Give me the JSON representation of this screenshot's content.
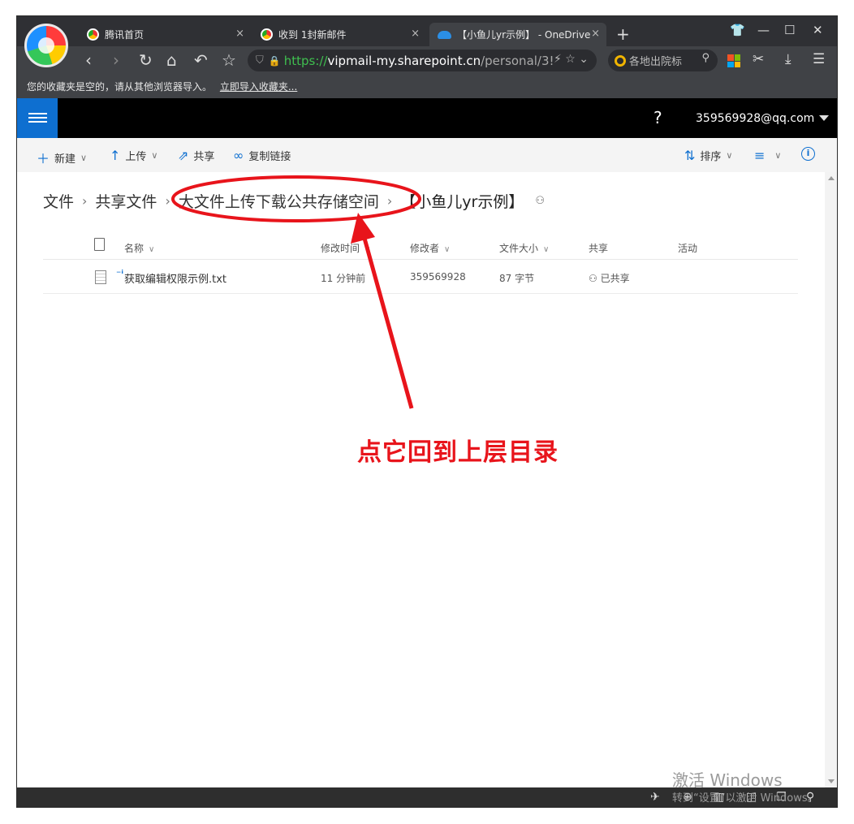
{
  "browser": {
    "tabs": [
      {
        "label": "腾讯首页",
        "close": "×"
      },
      {
        "label": "收到 1封新邮件",
        "close": "×"
      },
      {
        "label": "【小鱼儿yr示例】 - OneDrive",
        "close": "×"
      }
    ],
    "new_tab": "+",
    "url": {
      "scheme": "https://",
      "host": "vipmail-my.sharepoint.cn",
      "path": "/personal/3!"
    },
    "search_placeholder": "各地出院标",
    "bookmarks": {
      "message": "您的收藏夹是空的，请从其他浏览器导入。",
      "link": "立即导入收藏夹..."
    }
  },
  "header": {
    "help": "?",
    "account": "359569928@qq.com"
  },
  "commands": {
    "new": "新建",
    "upload": "上传",
    "share": "共享",
    "copy_link": "复制链接",
    "sort": "排序"
  },
  "breadcrumb": {
    "items": [
      "文件",
      "共享文件",
      "大文件上传下载公共存储空间",
      "【小鱼儿yr示例】"
    ]
  },
  "list": {
    "columns": {
      "name": "名称",
      "modified": "修改时间",
      "modified_by": "修改者",
      "size": "文件大小",
      "sharing": "共享",
      "activity": "活动"
    },
    "rows": [
      {
        "name": "获取编辑权限示例.txt",
        "modified": "11 分钟前",
        "modified_by": "359569928",
        "size": "87 字节",
        "sharing": "已共享"
      }
    ]
  },
  "annotation": {
    "text": "点它回到上层目录",
    "color": "#e8141b"
  },
  "watermark": {
    "line1": "激活 Windows",
    "line2": "转到“设置”以激活 Windows。"
  },
  "colors": {
    "accent": "#0e6fd0",
    "chrome": "#404246",
    "annotation": "#e8141b"
  }
}
